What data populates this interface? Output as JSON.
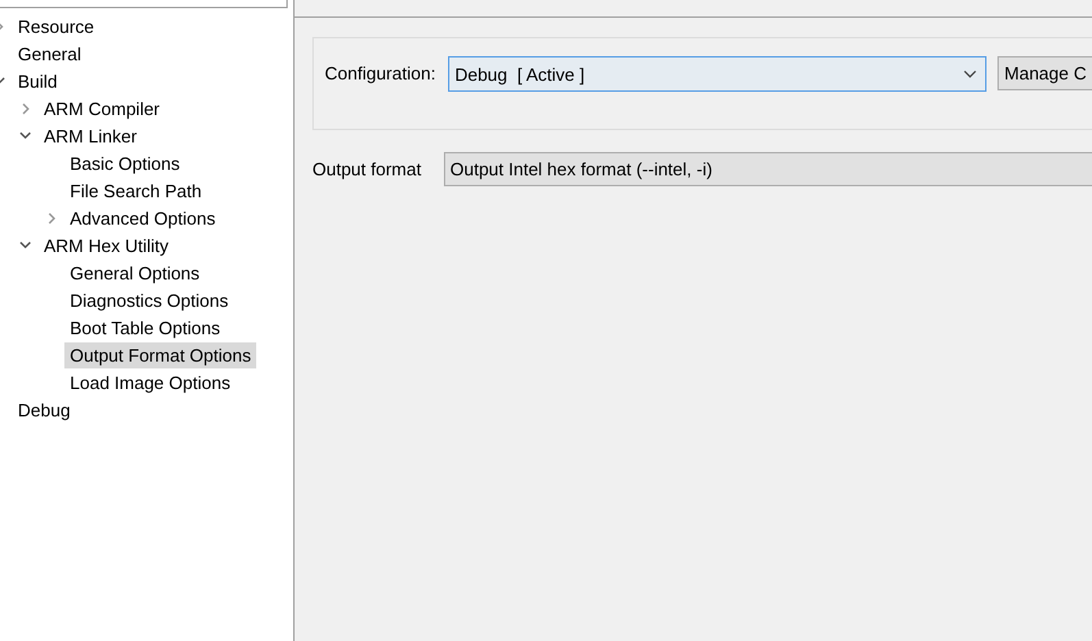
{
  "tree": [
    {
      "label": "Resource",
      "expanded": false,
      "selected": false
    },
    {
      "label": "General",
      "selected": false
    },
    {
      "label": "Build",
      "expanded": true,
      "selected": false,
      "children": [
        {
          "label": "ARM Compiler",
          "expanded": false,
          "selected": false
        },
        {
          "label": "ARM Linker",
          "expanded": true,
          "selected": false,
          "children": [
            {
              "label": "Basic Options",
              "selected": false
            },
            {
              "label": "File Search Path",
              "selected": false
            },
            {
              "label": "Advanced Options",
              "expanded": false,
              "selected": false
            }
          ]
        },
        {
          "label": "ARM Hex Utility",
          "expanded": true,
          "selected": false,
          "children": [
            {
              "label": "General Options",
              "selected": false
            },
            {
              "label": "Diagnostics Options",
              "selected": false
            },
            {
              "label": "Boot Table Options",
              "selected": false
            },
            {
              "label": "Output Format Options",
              "selected": true
            },
            {
              "label": "Load Image Options",
              "selected": false
            }
          ]
        }
      ]
    },
    {
      "label": "Debug",
      "selected": false
    }
  ],
  "configuration": {
    "label": "Configuration:",
    "value": "Debug  [ Active ]",
    "button": "Manage C"
  },
  "output_format": {
    "label": "Output format",
    "value": "Output Intel hex format (--intel, -i)"
  }
}
